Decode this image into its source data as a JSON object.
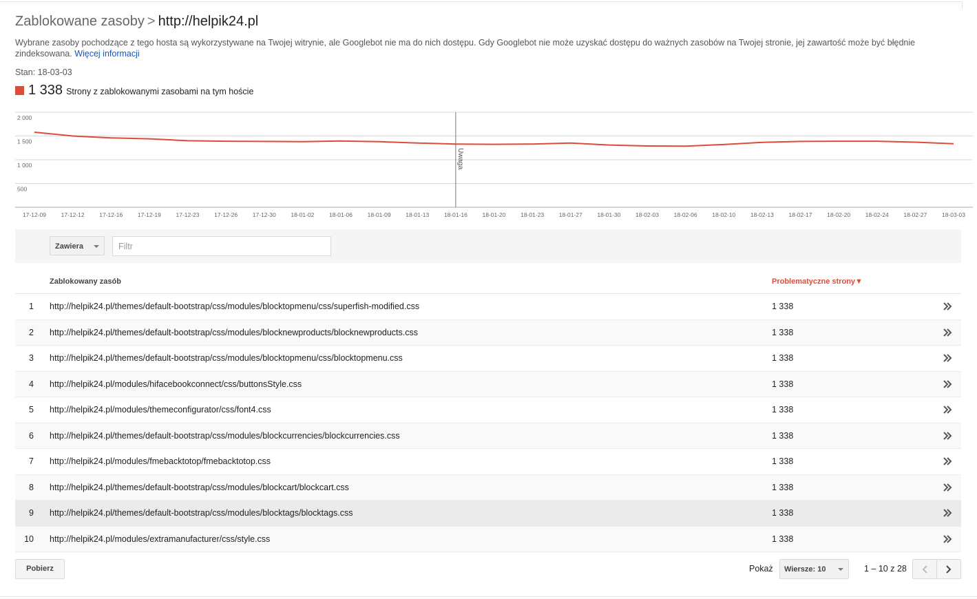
{
  "header": {
    "section": "Zablokowane zasoby",
    "separator": ">",
    "host": "http://helpik24.pl"
  },
  "description": {
    "text": "Wybrane zasoby pochodzące z tego hosta są wykorzystywane na Twojej witrynie, ale Googlebot nie ma do nich dostępu. Gdy Googlebot nie może uzyskać dostępu do ważnych zasobów na Twojej stronie, jej zawartość może być błędnie zindeksowana.",
    "link": "Więcej informacji"
  },
  "status": "Stan: 18-03-03",
  "stat": {
    "value": "1 338",
    "label": "Strony z zablokowanymi zasobami na tym hoście",
    "color": "#dd4b39"
  },
  "chart_data": {
    "type": "line",
    "y_ticks": [
      "2 000",
      "1 500",
      "1 000",
      "500"
    ],
    "ylim": [
      0,
      2000
    ],
    "grid": true,
    "annotation": {
      "label": "Uwaga",
      "at": "18-01-16"
    },
    "x_ticks": [
      "17-12-09",
      "17-12-12",
      "17-12-16",
      "17-12-19",
      "17-12-23",
      "17-12-26",
      "17-12-30",
      "18-01-02",
      "18-01-06",
      "18-01-09",
      "18-01-13",
      "18-01-16",
      "18-01-20",
      "18-01-23",
      "18-01-27",
      "18-01-30",
      "18-02-03",
      "18-02-06",
      "18-02-10",
      "18-02-13",
      "18-02-17",
      "18-02-20",
      "18-02-24",
      "18-02-27",
      "18-03-03"
    ],
    "series": [
      {
        "color": "#dd4b39",
        "x": [
          "17-12-09",
          "17-12-12",
          "17-12-16",
          "17-12-19",
          "17-12-23",
          "17-12-26",
          "17-12-30",
          "18-01-02",
          "18-01-06",
          "18-01-09",
          "18-01-13",
          "18-01-16",
          "18-01-20",
          "18-01-23",
          "18-01-27",
          "18-01-30",
          "18-02-03",
          "18-02-06",
          "18-02-10",
          "18-02-13",
          "18-02-17",
          "18-02-20",
          "18-02-24",
          "18-02-27",
          "18-03-03"
        ],
        "values": [
          1580,
          1500,
          1460,
          1440,
          1400,
          1390,
          1385,
          1380,
          1395,
          1380,
          1350,
          1330,
          1325,
          1330,
          1350,
          1310,
          1290,
          1285,
          1320,
          1365,
          1385,
          1390,
          1390,
          1370,
          1338
        ]
      }
    ]
  },
  "filter": {
    "mode": "Zawiera",
    "placeholder": "Filtr"
  },
  "table": {
    "col_resource": "Zablokowany zasób",
    "col_pages": "Problematyczne strony",
    "rows": [
      {
        "n": "1",
        "url": "http://helpik24.pl/themes/default-bootstrap/css/modules/blocktopmenu/css/superfish-modified.css",
        "count": "1 338"
      },
      {
        "n": "2",
        "url": "http://helpik24.pl/themes/default-bootstrap/css/modules/blocknewproducts/blocknewproducts.css",
        "count": "1 338"
      },
      {
        "n": "3",
        "url": "http://helpik24.pl/themes/default-bootstrap/css/modules/blocktopmenu/css/blocktopmenu.css",
        "count": "1 338"
      },
      {
        "n": "4",
        "url": "http://helpik24.pl/modules/hifacebookconnect/css/buttonsStyle.css",
        "count": "1 338"
      },
      {
        "n": "5",
        "url": "http://helpik24.pl/modules/themeconfigurator/css/font4.css",
        "count": "1 338"
      },
      {
        "n": "6",
        "url": "http://helpik24.pl/themes/default-bootstrap/css/modules/blockcurrencies/blockcurrencies.css",
        "count": "1 338"
      },
      {
        "n": "7",
        "url": "http://helpik24.pl/modules/fmebacktotop/fmebacktotop.css",
        "count": "1 338"
      },
      {
        "n": "8",
        "url": "http://helpik24.pl/themes/default-bootstrap/css/modules/blockcart/blockcart.css",
        "count": "1 338"
      },
      {
        "n": "9",
        "url": "http://helpik24.pl/themes/default-bootstrap/css/modules/blocktags/blocktags.css",
        "count": "1 338"
      },
      {
        "n": "10",
        "url": "http://helpik24.pl/modules/extramanufacturer/css/style.css",
        "count": "1 338"
      }
    ]
  },
  "footer": {
    "download": "Pobierz",
    "show_label": "Pokaż",
    "rows_select": "Wiersze: 10",
    "range": "1 – 10 z 28"
  }
}
